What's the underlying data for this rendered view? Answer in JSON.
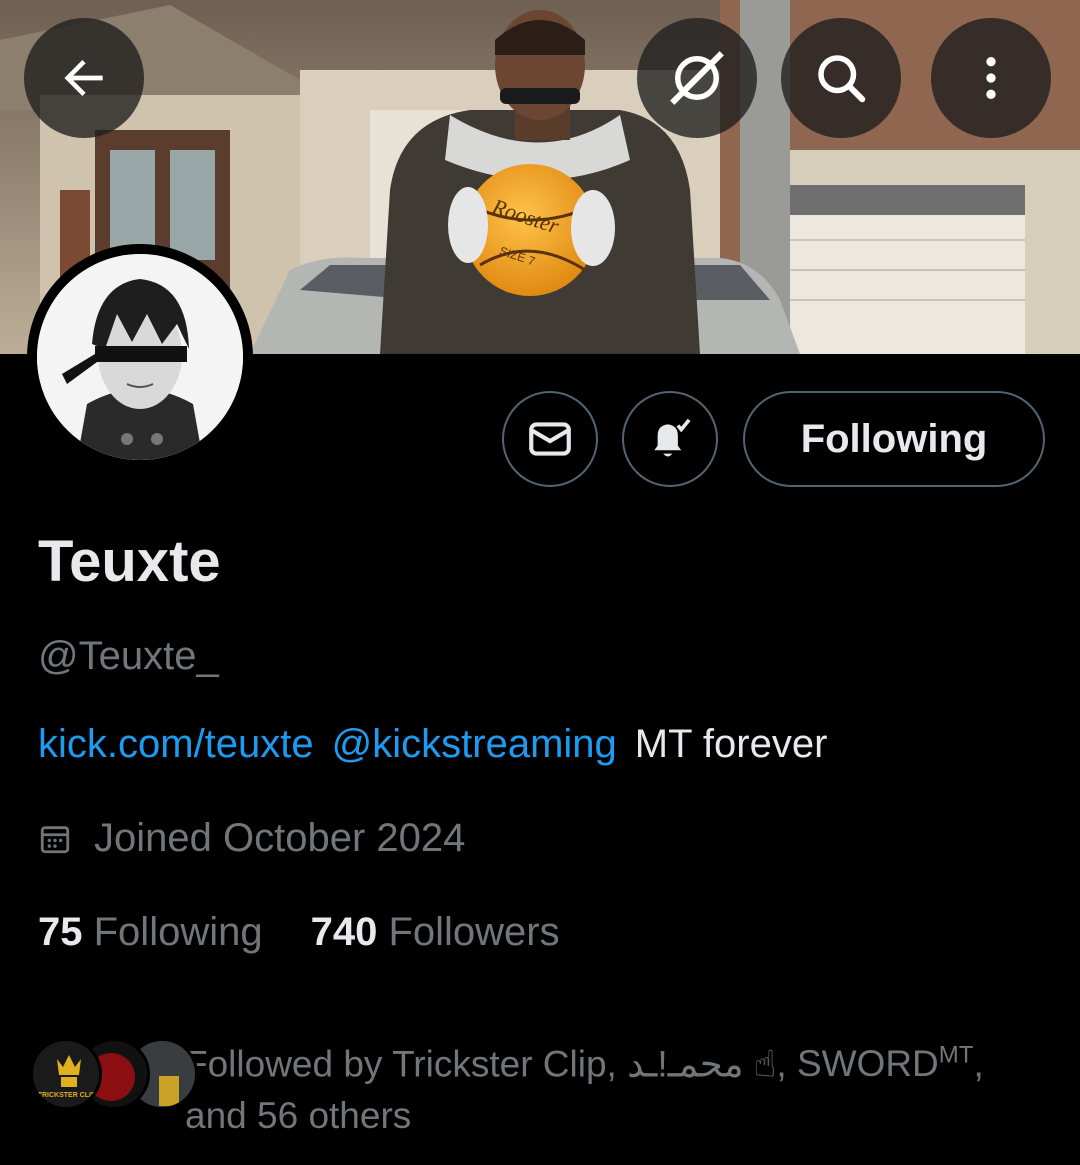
{
  "header": {
    "back_icon": "arrow-left-icon",
    "grok_icon": "grok-icon",
    "search_icon": "search-icon",
    "more_icon": "more-vertical-icon"
  },
  "banner": {
    "description_alt": "",
    "ball_text": "Rooster",
    "ball_size": "SIZE 7"
  },
  "actions": {
    "message_icon": "mail-icon",
    "notify_icon": "bell-check-icon",
    "following_label": "Following"
  },
  "profile": {
    "display_name": "Teuxte",
    "handle": "@Teuxte_",
    "bio_link": "kick.com/teuxte",
    "bio_mention": "@kickstreaming",
    "bio_text": "MT forever",
    "joined": "Joined October 2024",
    "following_count": "75",
    "following_label": "Following",
    "followers_count": "740",
    "followers_label": "Followers"
  },
  "followed_by": {
    "prefix": "Followed by",
    "name1": "Trickster Clip",
    "name2": "محمـ!ـد ☝",
    "name3": "SWORD",
    "name3_sup": "MT",
    "suffix": "and 56 others",
    "avatar1_text": "TRICKSTER CLIPS"
  },
  "colors": {
    "accent": "#1d9bf0",
    "muted": "#71767b",
    "text": "#e7e9ea",
    "border": "#536471",
    "background": "#000000"
  }
}
